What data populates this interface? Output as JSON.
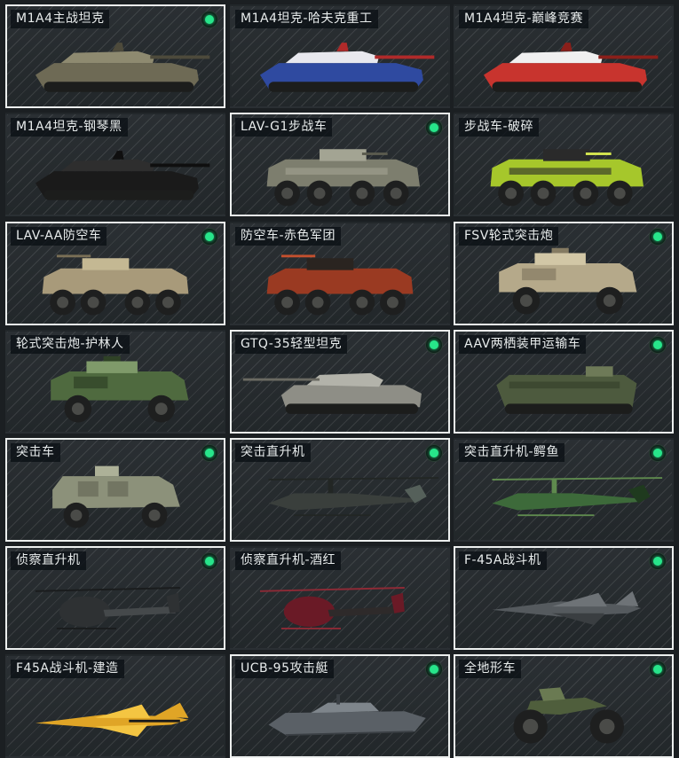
{
  "vehicles": [
    {
      "name": "M1A4主战坦克",
      "owned": true,
      "selected": true,
      "kind": "tank",
      "colors": [
        "#6e6a55",
        "#8e8a70",
        "#4d4a3b"
      ]
    },
    {
      "name": "M1A4坦克-哈夫克重工",
      "owned": false,
      "selected": false,
      "kind": "tank",
      "colors": [
        "#2f4aa0",
        "#e8e8ee",
        "#b02a2a"
      ]
    },
    {
      "name": "M1A4坦克-巅峰竞赛",
      "owned": false,
      "selected": false,
      "kind": "tank",
      "colors": [
        "#c8342e",
        "#f0f0f0",
        "#8a1f1a"
      ]
    },
    {
      "name": "M1A4坦克-钢琴黑",
      "owned": false,
      "selected": false,
      "kind": "tank",
      "colors": [
        "#1a1a1a",
        "#2e2e2e",
        "#0f0f0f"
      ]
    },
    {
      "name": "LAV-G1步战车",
      "owned": true,
      "selected": true,
      "kind": "ifv",
      "colors": [
        "#7d7e6e",
        "#a3a493",
        "#5a5b4e"
      ]
    },
    {
      "name": "步战车-破碎",
      "owned": false,
      "selected": false,
      "kind": "ifv",
      "colors": [
        "#a6c72b",
        "#2a2a2a",
        "#d6e850"
      ]
    },
    {
      "name": "LAV-AA防空车",
      "owned": true,
      "selected": true,
      "kind": "aa",
      "colors": [
        "#a89a7a",
        "#c4b893",
        "#7a6f56"
      ]
    },
    {
      "name": "防空车-赤色军团",
      "owned": false,
      "selected": false,
      "kind": "aa",
      "colors": [
        "#9a3a22",
        "#2a2420",
        "#c4502e"
      ]
    },
    {
      "name": "FSV轮式突击炮",
      "owned": true,
      "selected": true,
      "kind": "fsv",
      "colors": [
        "#b5a98a",
        "#d2c7a6",
        "#857b62"
      ]
    },
    {
      "name": "轮式突击炮-护林人",
      "owned": false,
      "selected": false,
      "kind": "fsv",
      "colors": [
        "#4f6a3f",
        "#7f9a6a",
        "#2f4226"
      ]
    },
    {
      "name": "GTQ-35轻型坦克",
      "owned": true,
      "selected": true,
      "kind": "light",
      "colors": [
        "#8e8e86",
        "#b3b3aa",
        "#6a6a62"
      ]
    },
    {
      "name": "AAV两栖装甲运输车",
      "owned": true,
      "selected": true,
      "kind": "aav",
      "colors": [
        "#4d5a3e",
        "#6e7a58",
        "#343d2a"
      ]
    },
    {
      "name": "突击车",
      "owned": true,
      "selected": true,
      "kind": "mrap",
      "colors": [
        "#8c917a",
        "#adb198",
        "#666a58"
      ]
    },
    {
      "name": "突击直升机",
      "owned": true,
      "selected": true,
      "kind": "heli",
      "colors": [
        "#3a3f3c",
        "#55605a",
        "#222624"
      ]
    },
    {
      "name": "突击直升机-鳄鱼",
      "owned": true,
      "selected": false,
      "kind": "heli",
      "colors": [
        "#3d6a3a",
        "#1f3a1e",
        "#5f8a4e"
      ]
    },
    {
      "name": "侦察直升机",
      "owned": true,
      "selected": true,
      "kind": "scout",
      "colors": [
        "#2e3133",
        "#45494b",
        "#1a1c1d"
      ]
    },
    {
      "name": "侦察直升机-酒红",
      "owned": false,
      "selected": false,
      "kind": "scout",
      "colors": [
        "#6a1a26",
        "#2e2a2a",
        "#8e2a36"
      ]
    },
    {
      "name": "F-45A战斗机",
      "owned": true,
      "selected": true,
      "kind": "jet",
      "colors": [
        "#555a5e",
        "#6e7377",
        "#3a3e41"
      ]
    },
    {
      "name": "F45A战斗机-建造",
      "owned": false,
      "selected": false,
      "kind": "jetY",
      "colors": [
        "#e0a526",
        "#1a1a1a",
        "#f4c542"
      ]
    },
    {
      "name": "UCB-95攻击艇",
      "owned": true,
      "selected": true,
      "kind": "boat",
      "colors": [
        "#5a6066",
        "#7e858b",
        "#3a3f44"
      ]
    },
    {
      "name": "全地形车",
      "owned": true,
      "selected": true,
      "kind": "atv",
      "colors": [
        "#4f5e3c",
        "#6a7a52",
        "#222522"
      ]
    }
  ]
}
